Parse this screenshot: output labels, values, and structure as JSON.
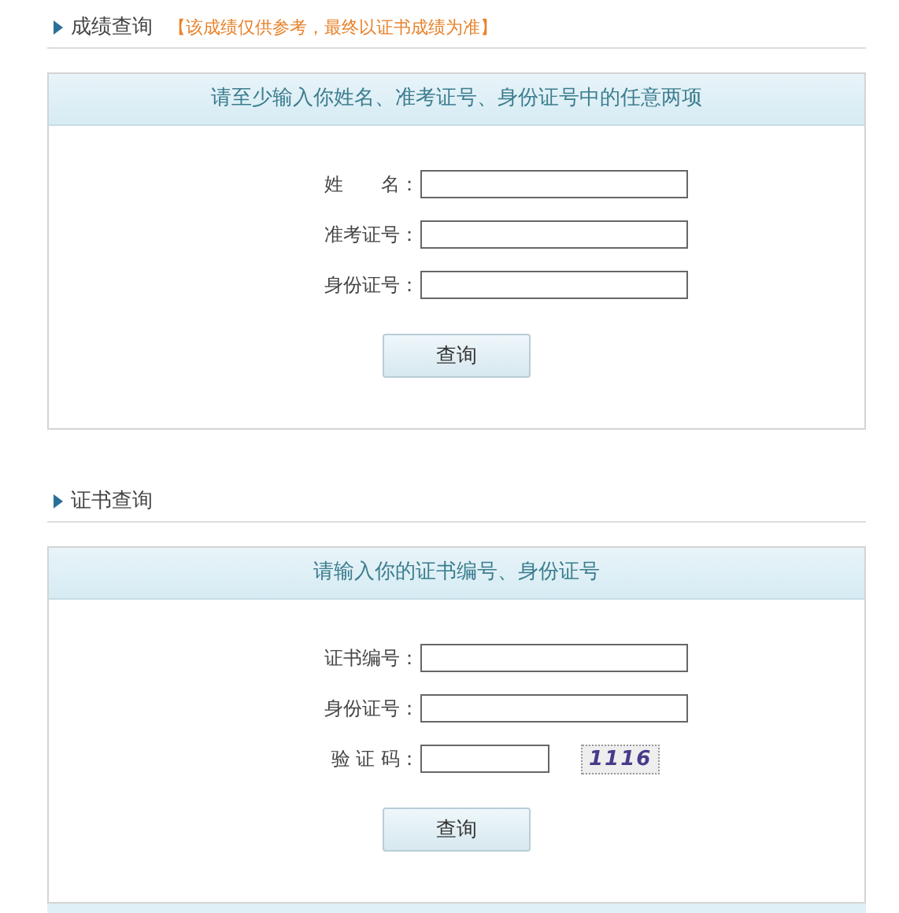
{
  "sections": [
    {
      "title": "成绩查询",
      "note": "【该成绩仅供参考，最终以证书成绩为准】",
      "instruction": "请至少输入你姓名、准考证号、身份证号中的任意两项",
      "fields": [
        {
          "kind": "text",
          "label": "姓　　名："
        },
        {
          "kind": "text",
          "label": "准考证号："
        },
        {
          "kind": "text",
          "label": "身份证号："
        }
      ],
      "button": "查询"
    },
    {
      "title": "证书查询",
      "instruction": "请输入你的证书编号、身份证号",
      "fields": [
        {
          "kind": "text",
          "label": "证书编号："
        },
        {
          "kind": "text",
          "label": "身份证号："
        },
        {
          "kind": "captcha",
          "label": "验 证 码：",
          "captcha": "1116"
        }
      ],
      "button": "查询"
    }
  ]
}
